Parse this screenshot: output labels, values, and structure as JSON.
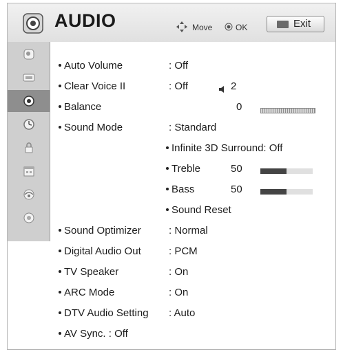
{
  "header": {
    "title": "AUDIO",
    "icon": "speaker-cone-icon",
    "hint_move": "Move",
    "hint_ok": "OK",
    "exit_label": "Exit"
  },
  "sidebar": {
    "items": [
      {
        "name": "picture-icon"
      },
      {
        "name": "screen-icon"
      },
      {
        "name": "audio-icon",
        "active": true
      },
      {
        "name": "clock-icon"
      },
      {
        "name": "lock-icon"
      },
      {
        "name": "calendar-icon"
      },
      {
        "name": "network-icon"
      },
      {
        "name": "support-icon"
      }
    ]
  },
  "menu": {
    "auto_volume": {
      "label": "Auto Volume",
      "value": ": Off"
    },
    "clear_voice": {
      "label": "Clear Voice II",
      "value": ": Off",
      "level": "2",
      "level_icon": "speaker-level-icon"
    },
    "balance": {
      "label": "Balance",
      "value": "0",
      "position": 0.5
    },
    "sound_mode": {
      "label": "Sound Mode",
      "value": ": Standard"
    },
    "surround": {
      "label": "Infinite 3D Surround: Off"
    },
    "treble": {
      "label": "Treble",
      "value": "50",
      "level": 0.5
    },
    "bass": {
      "label": "Bass",
      "value": "50",
      "level": 0.5
    },
    "sound_reset": {
      "label": "Sound Reset"
    },
    "sound_optimizer": {
      "label": "Sound Optimizer",
      "value": ": Normal"
    },
    "digital_audio_out": {
      "label": "Digital Audio Out",
      "value": ": PCM"
    },
    "tv_speaker": {
      "label": "TV Speaker",
      "value": ": On"
    },
    "arc_mode": {
      "label": "ARC Mode",
      "value": ": On"
    },
    "dtv_audio": {
      "label": "DTV Audio Setting",
      "value": ": Auto"
    },
    "av_sync": {
      "label": "AV Sync.  : Off"
    }
  }
}
